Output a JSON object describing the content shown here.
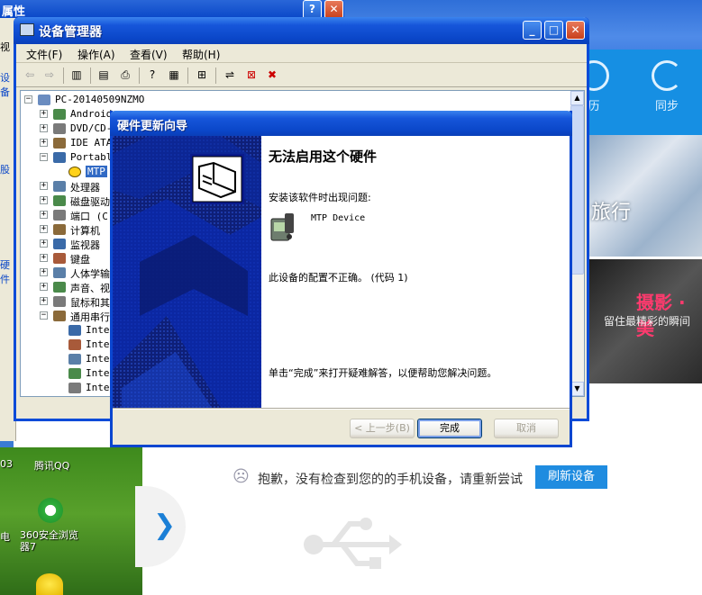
{
  "background_window": {
    "title": "属性",
    "left_labels": [
      "视",
      "设备",
      "股",
      "硬件"
    ]
  },
  "qq_assistant": {
    "buttons": [
      "历",
      "同步"
    ],
    "banner1_text": "旅行",
    "banner2_title": "摄影 · 美",
    "banner2_sub": "留住最精彩的瞬间",
    "no_device_message": "抱歉，没有检查到您的的手机设备，请重新尝试",
    "refresh_button": "刷新设备"
  },
  "desktop": {
    "icons": [
      "腾讯QQ",
      "360安全浏览器7"
    ],
    "left_labels": [
      "03",
      "电"
    ]
  },
  "device_manager": {
    "title": "设备管理器",
    "menu": [
      "文件(F)",
      "操作(A)",
      "查看(V)",
      "帮助(H)"
    ],
    "tree": [
      {
        "label": "PC-20140509NZMO",
        "level": 0,
        "expander": "-"
      },
      {
        "label": "Android",
        "level": 1,
        "expander": "+"
      },
      {
        "label": "DVD/CD-",
        "level": 1,
        "expander": "+"
      },
      {
        "label": "IDE ATA",
        "level": 1,
        "expander": "+"
      },
      {
        "label": "Portabl",
        "level": 1,
        "expander": "-"
      },
      {
        "label": "MTP",
        "level": 2,
        "expander": "",
        "selected": true,
        "warning": true
      },
      {
        "label": "处理器",
        "level": 1,
        "expander": "+"
      },
      {
        "label": "磁盘驱动",
        "level": 1,
        "expander": "+"
      },
      {
        "label": "端口 (C",
        "level": 1,
        "expander": "+"
      },
      {
        "label": "计算机",
        "level": 1,
        "expander": "+"
      },
      {
        "label": "监视器",
        "level": 1,
        "expander": "+"
      },
      {
        "label": "键盘",
        "level": 1,
        "expander": "+"
      },
      {
        "label": "人体学输",
        "level": 1,
        "expander": "+"
      },
      {
        "label": "声音、视",
        "level": 1,
        "expander": "+"
      },
      {
        "label": "鼠标和其",
        "level": 1,
        "expander": "+"
      },
      {
        "label": "通用串行",
        "level": 1,
        "expander": "-"
      },
      {
        "label": "Inte",
        "level": 2,
        "expander": ""
      },
      {
        "label": "Inte",
        "level": 2,
        "expander": ""
      },
      {
        "label": "Inte",
        "level": 2,
        "expander": ""
      },
      {
        "label": "Inte",
        "level": 2,
        "expander": ""
      },
      {
        "label": "Inte",
        "level": 2,
        "expander": ""
      }
    ]
  },
  "wizard": {
    "title": "硬件更新向导",
    "heading": "无法启用这个硬件",
    "problem_intro": "安装该软件时出现问题:",
    "device_name": "MTP Device",
    "error_text": "此设备的配置不正确。 (代码 1)",
    "finish_hint": "单击“完成”来打开疑难解答，以便帮助您解决问题。",
    "back_button": "< 上一步(B)",
    "finish_button": "完成",
    "cancel_button": "取消"
  },
  "colors": {
    "xp_title_blue": "#0a46c8",
    "qq_blue": "#168fe3",
    "wizard_art": "#10207a"
  }
}
